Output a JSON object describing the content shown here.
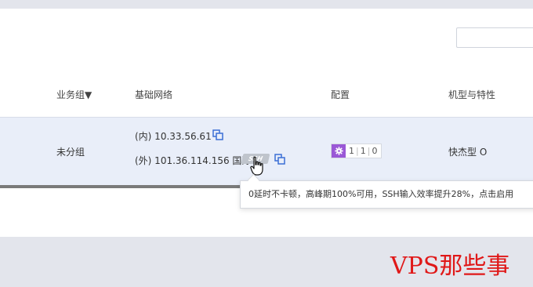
{
  "table": {
    "columns": {
      "business_group": "业务组▼",
      "network": "基础网络",
      "config": "配置",
      "model": "机型与特性"
    },
    "rows": [
      {
        "business_group": "未分组",
        "internal_ip": "(内) 10.33.56.61",
        "external_ip": "(外) 101.36.114.156 国际",
        "ssh_badge": "SSH",
        "config": {
          "a": "1",
          "b": "1",
          "c": "0"
        },
        "model": "快杰型 O"
      }
    ]
  },
  "tooltip": {
    "text": "0延时不卡顿，高峰期100%可用，SSH输入效率提升28%，点击启用"
  },
  "watermark": "VPS那些事",
  "colors": {
    "row_highlight": "#e9eef9",
    "config_accent": "#9a58d6",
    "copy_icon": "#3b6fd6",
    "watermark": "#e01818"
  },
  "icons": [
    "copy-icon",
    "gear-icon",
    "hand-cursor-icon"
  ]
}
